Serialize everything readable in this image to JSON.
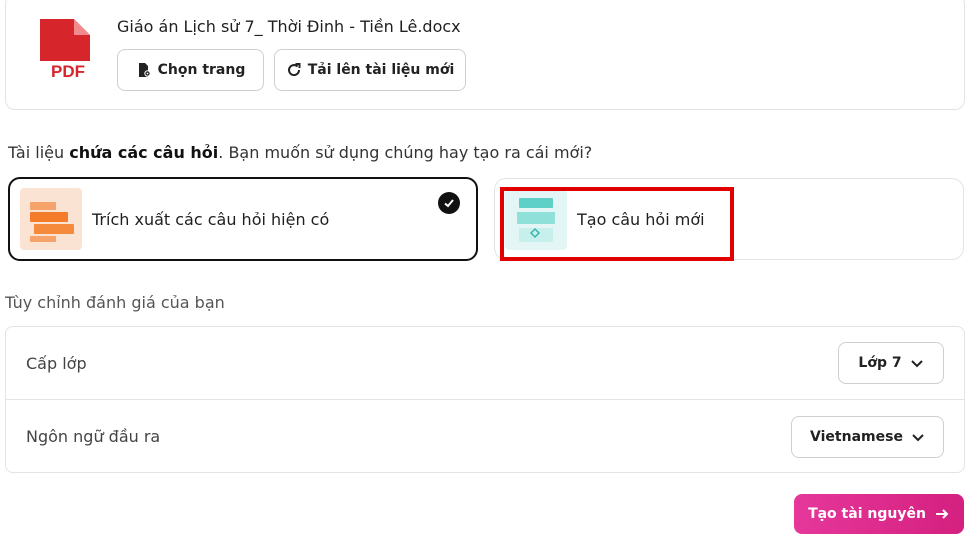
{
  "file": {
    "icon": "pdf-file-icon",
    "icon_text": "PDF",
    "name": "Giáo án Lịch sử 7_ Thời Đinh - Tiền Lê.docx",
    "choose_page_label": "Chọn trang",
    "upload_new_label": "Tải lên tài liệu mới"
  },
  "question": {
    "prefix": "Tài liệu ",
    "bold": "chứa các câu hỏi",
    "suffix": ". Bạn muốn sử dụng chúng hay tạo ra cái mới?"
  },
  "options": [
    {
      "label": "Trích xuất các câu hỏi hiện có",
      "selected": true,
      "icon": "extract-questions-icon"
    },
    {
      "label": "Tạo câu hỏi mới",
      "selected": false,
      "icon": "new-questions-icon"
    }
  ],
  "customize": {
    "title": "Tùy chỉnh đánh giá của bạn",
    "grade_label": "Cấp lớp",
    "grade_value": "Lớp 7",
    "language_label": "Ngôn ngữ đầu ra",
    "language_value": "Vietnamese"
  },
  "create_button_label": "Tạo tài nguyên",
  "colors": {
    "pdf_red": "#d6262c",
    "accent_pink": "#e6379b",
    "highlight_red": "#e00000"
  }
}
